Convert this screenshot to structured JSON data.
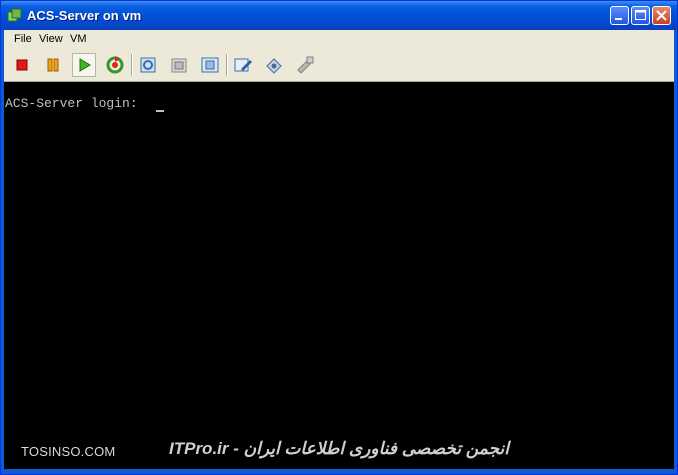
{
  "window": {
    "title": "ACS-Server on vm"
  },
  "title_buttons": {
    "minimize": "minimize",
    "maximize": "maximize",
    "close": "close"
  },
  "menu": {
    "items": [
      "File",
      "View",
      "VM"
    ]
  },
  "toolbar": {
    "tools": [
      "stop",
      "pause",
      "play",
      "reset",
      "snapshot",
      "revert",
      "snapshot-manager",
      "edit-settings",
      "tools-install",
      "settings"
    ]
  },
  "console": {
    "line": "ACS-Server login: "
  },
  "watermark": {
    "left": "TOSINSO.COM",
    "right": "ITPro.ir - انجمن تخصصی فناوری اطلاعات ایران"
  },
  "colors": {
    "titlebar": "#0152d9",
    "console_bg": "#000000",
    "console_text": "#c0c0c0"
  }
}
